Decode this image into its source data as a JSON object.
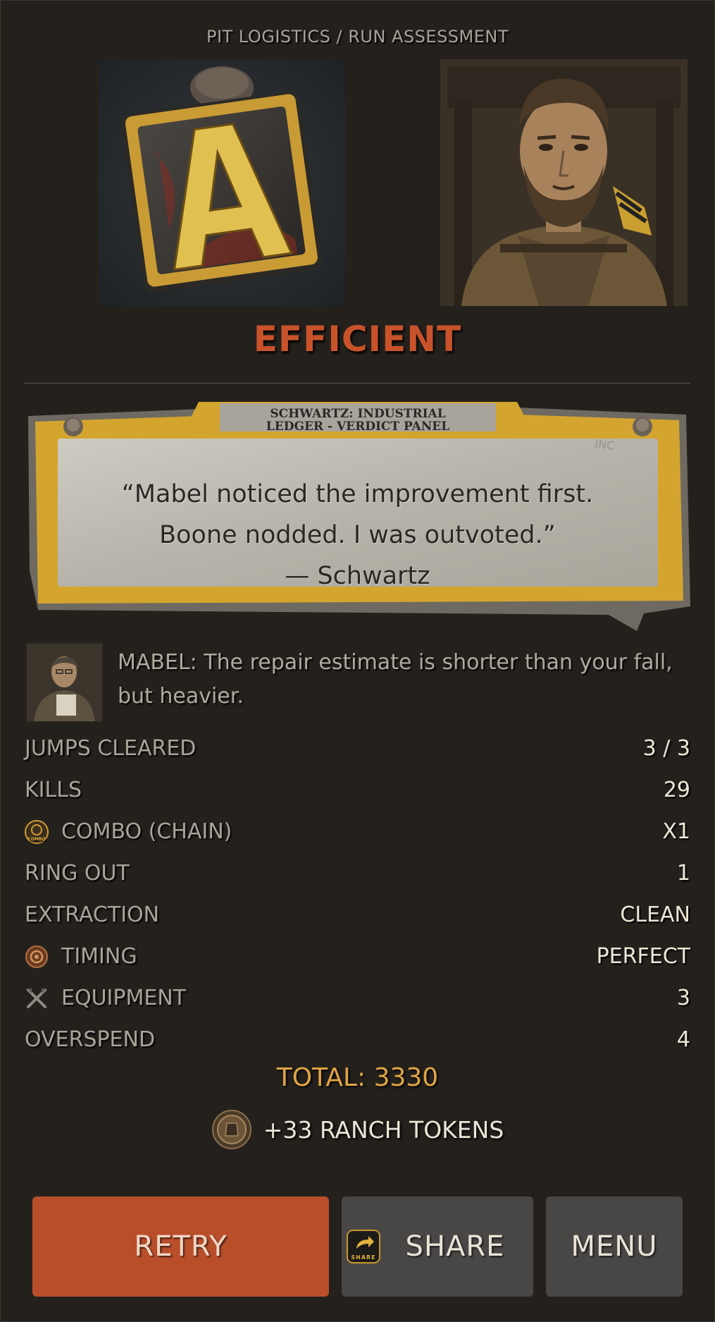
{
  "header": {
    "title": "PIT LOGISTICS / RUN ASSESSMENT"
  },
  "grade": {
    "letter": "A",
    "icon": "grade-stamp-icon"
  },
  "rating": {
    "label": "EFFICIENT",
    "color": "#c8522a"
  },
  "verdict_panel": {
    "title_line1": "SCHWARTZ: INDUSTRIAL",
    "title_line2": "LEDGER - VERDICT PANEL",
    "stamp_text": "INC",
    "quote_line1": "“Mabel noticed the improvement first.",
    "quote_line2": "Boone nodded. I was outvoted.”",
    "attribution": "— Schwartz"
  },
  "mabel": {
    "text": "MABEL: The repair estimate is shorter than your fall, but heavier."
  },
  "stats": [
    {
      "label": "JUMPS CLEARED",
      "value": "3 / 3",
      "icon": ""
    },
    {
      "label": "KILLS",
      "value": "29",
      "icon": ""
    },
    {
      "label": "COMBO (CHAIN)",
      "value": "X1",
      "icon": "combo-badge-icon",
      "icon_text": "COMBO"
    },
    {
      "label": "RING OUT",
      "value": "1",
      "icon": ""
    },
    {
      "label": "EXTRACTION",
      "value": "CLEAN",
      "icon": ""
    },
    {
      "label": "TIMING",
      "value": "PERFECT",
      "icon": "timing-medal-icon"
    },
    {
      "label": "EQUIPMENT",
      "value": "3",
      "icon": "crossed-tools-icon"
    },
    {
      "label": "OVERSPEND",
      "value": "4",
      "icon": ""
    }
  ],
  "total": {
    "text": "TOTAL: 3330"
  },
  "reward": {
    "text": "+33 RANCH TOKENS",
    "icon": "ranch-token-icon"
  },
  "buttons": {
    "retry": "RETRY",
    "share": "SHARE",
    "share_icon_text": "SHARE",
    "menu": "MENU"
  },
  "colors": {
    "background": "#24211d",
    "accent": "#c8522a",
    "total": "#e0a545",
    "button": "#494745"
  }
}
